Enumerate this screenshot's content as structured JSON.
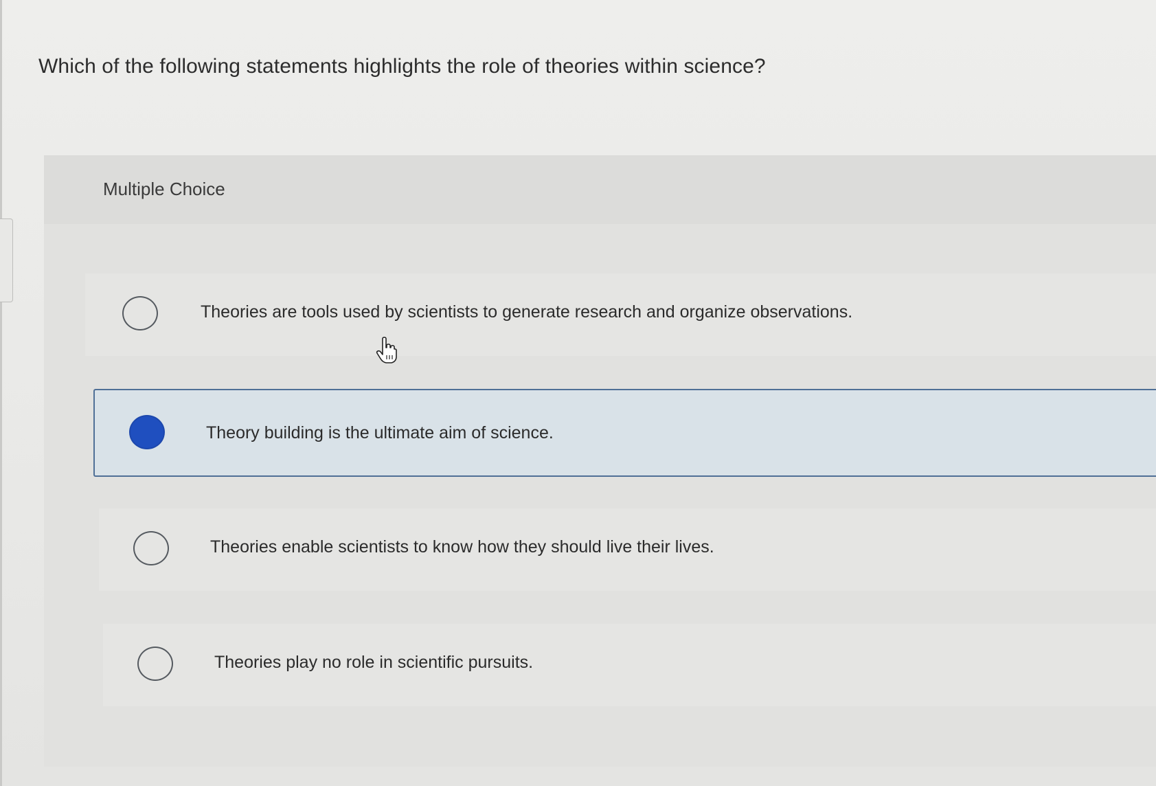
{
  "question": {
    "text": "Which of the following statements highlights the role of theories within science?"
  },
  "panel": {
    "type_label": "Multiple Choice"
  },
  "options": [
    {
      "label": "Theories are tools used by scientists to generate research and organize observations.",
      "selected": false
    },
    {
      "label": "Theory building is the ultimate aim of science.",
      "selected": true
    },
    {
      "label": "Theories enable scientists to know how they should live their lives.",
      "selected": false
    },
    {
      "label": "Theories play no role in scientific pursuits.",
      "selected": false
    }
  ],
  "colors": {
    "selected_radio": "#1f4fbf",
    "selected_border": "#4f6f96",
    "selected_background": "#d9e2e8"
  },
  "icons": {
    "cursor": "hand-pointer-icon"
  }
}
